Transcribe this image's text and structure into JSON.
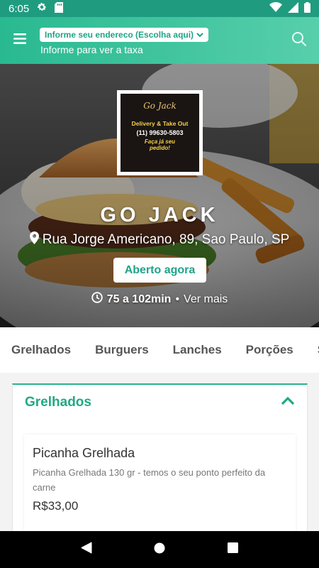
{
  "status_bar": {
    "time": "6:05",
    "icons": [
      "gear-icon",
      "sd-card-icon",
      "wifi-icon",
      "signal-icon",
      "battery-icon"
    ]
  },
  "app_bar": {
    "address_prompt": "Informe seu endereco (Escolha aqui)",
    "fee_hint": "Informe para ver a taxa",
    "accent_color": "#29b991",
    "icons": [
      "menu-icon",
      "chevron-down-icon",
      "search-icon"
    ]
  },
  "restaurant": {
    "name": "GO JACK",
    "address": "Rua Jorge Americano, 89, Sao Paulo, SP",
    "status": "Aberto agora",
    "delivery_time": "75 a 102min",
    "separator": "•",
    "more_link": "Ver mais",
    "logo": {
      "script": "Go Jack",
      "line1": "Delivery & Take Out",
      "phone": "(11) 99630-5803",
      "line3a": "Faça já seu",
      "line3b": "pedido!"
    }
  },
  "categories": [
    "Grelhados",
    "Burguers",
    "Lanches",
    "Porções",
    "S"
  ],
  "section": {
    "title": "Grelhados",
    "products": [
      {
        "name": "Picanha Grelhada",
        "description": "Picanha Grelhada 130 gr - temos o seu ponto perfeito da carne",
        "price": "R$33,00"
      }
    ]
  },
  "nav_bar": {
    "icons": [
      "back-icon",
      "home-icon",
      "recents-icon"
    ]
  }
}
